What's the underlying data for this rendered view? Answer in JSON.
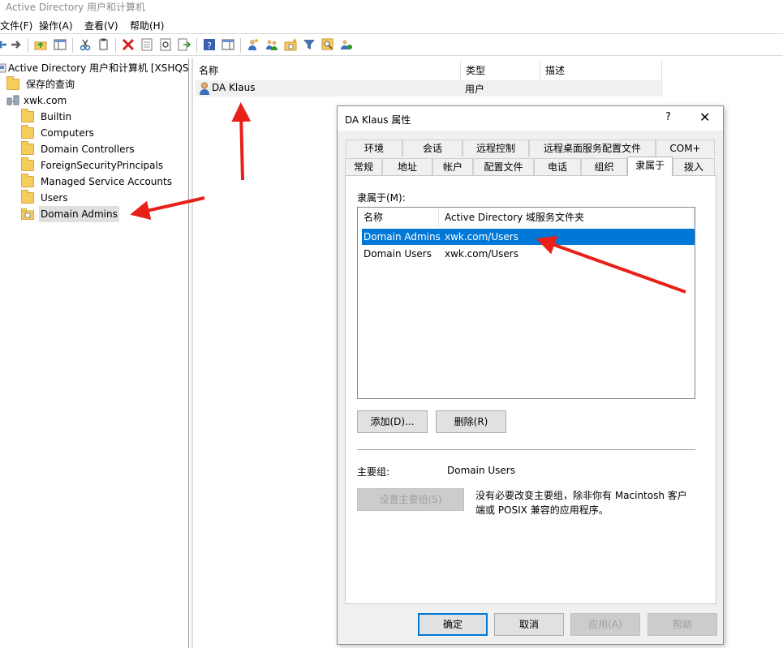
{
  "window": {
    "title": "Active Directory 用户和计算机"
  },
  "menu": [
    "文件(F)",
    "操作(A)",
    "查看(V)",
    "帮助(H)"
  ],
  "toolbar": {
    "icons": [
      "back-icon",
      "forward-icon",
      "up-folder-icon",
      "show-hide-tree-icon",
      "cut-icon",
      "copy-icon",
      "delete-icon",
      "properties-icon",
      "refresh-icon",
      "export-list-icon",
      "help-icon",
      "show-action-pane-icon",
      "new-user-icon",
      "new-group-icon",
      "new-ou-icon",
      "filter-icon",
      "find-icon",
      "add-to-group-icon"
    ]
  },
  "tree": {
    "root": "Active Directory 用户和计算机 [XSHQSD",
    "saved_queries": "保存的查询",
    "domain": "xwk.com",
    "containers": [
      "Builtin",
      "Computers",
      "Domain Controllers",
      "ForeignSecurityPrincipals",
      "Managed Service Accounts",
      "Users",
      "Domain Admins"
    ]
  },
  "list": {
    "columns": [
      "名称",
      "类型",
      "描述"
    ],
    "rows": [
      {
        "name": "DA Klaus",
        "type": "用户",
        "desc": ""
      }
    ]
  },
  "dialog": {
    "title": "DA Klaus 属性",
    "help": "?",
    "close": "✕",
    "tabs_row1": [
      "环境",
      "会话",
      "远程控制",
      "远程桌面服务配置文件",
      "COM+"
    ],
    "tabs_row2": [
      "常规",
      "地址",
      "帐户",
      "配置文件",
      "电话",
      "组织",
      "隶属于",
      "拨入"
    ],
    "active_tab": "隶属于",
    "member_of_label": "隶属于(M):",
    "member_columns": [
      "名称",
      "Active Directory 域服务文件夹"
    ],
    "members": [
      {
        "name": "Domain Admins",
        "folder": "xwk.com/Users"
      },
      {
        "name": "Domain Users",
        "folder": "xwk.com/Users"
      }
    ],
    "add_button": "添加(D)...",
    "remove_button": "删除(R)",
    "primary_group_label": "主要组:",
    "primary_group_value": "Domain Users",
    "set_primary_button": "设置主要组(S)",
    "primary_note_line1": "没有必要改变主要组，除非你有 Macintosh 客户",
    "primary_note_line2": "端或 POSIX 兼容的应用程序。",
    "ok": "确定",
    "cancel": "取消",
    "apply": "应用(A)",
    "help_button": "帮助"
  },
  "colors": {
    "selection": "#0078d7",
    "annotation_arrow": "#e8201a",
    "folder": "#f6cc5c"
  }
}
